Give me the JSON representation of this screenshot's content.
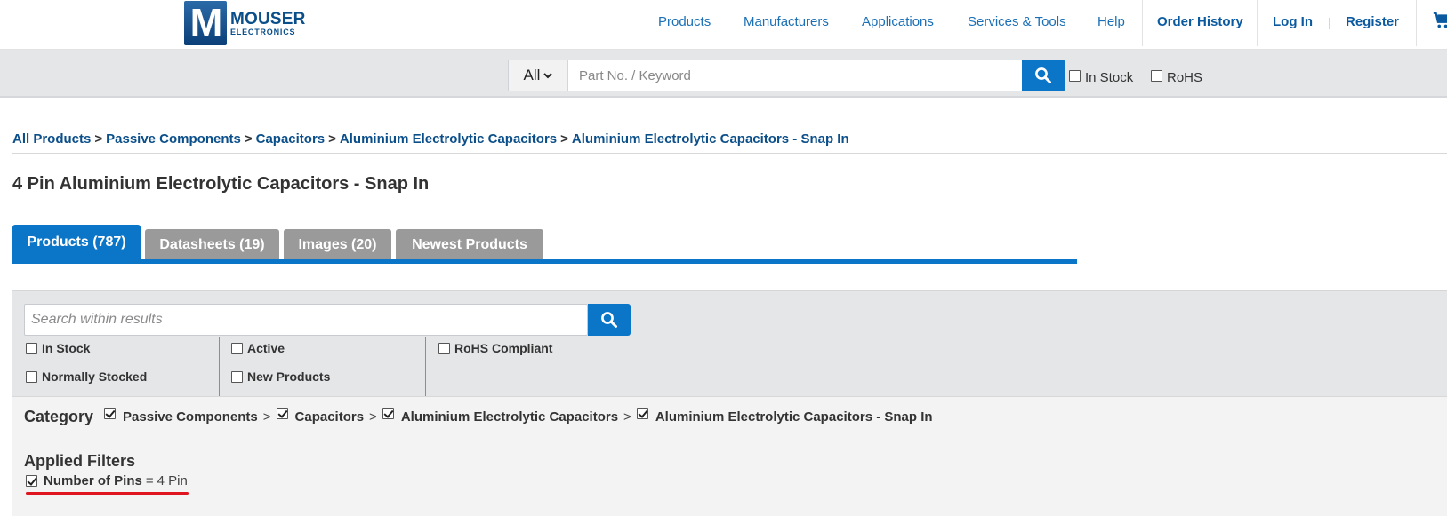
{
  "brand": {
    "mark": "M",
    "line1": "MOUSER",
    "line2": "ELECTRONICS"
  },
  "nav": {
    "products": "Products",
    "manufacturers": "Manufacturers",
    "applications": "Applications",
    "services": "Services & Tools",
    "help": "Help",
    "order_history": "Order History",
    "login": "Log In",
    "pipe": "|",
    "register": "Register"
  },
  "search": {
    "scope": "All",
    "placeholder": "Part No. / Keyword",
    "in_stock_label": "In Stock",
    "rohs_label": "RoHS"
  },
  "breadcrumb": {
    "items": [
      "All Products",
      "Passive Components",
      "Capacitors",
      "Aluminium Electrolytic Capacitors",
      "Aluminium Electrolytic Capacitors - Snap In"
    ],
    "separator": ">"
  },
  "page_title": "4 Pin Aluminium Electrolytic Capacitors - Snap In",
  "tabs": [
    {
      "label": "Products (787)",
      "active": true
    },
    {
      "label": "Datasheets (19)",
      "active": false
    },
    {
      "label": "Images (20)",
      "active": false
    },
    {
      "label": "Newest Products",
      "active": false
    }
  ],
  "filters": {
    "search_placeholder": "Search within results",
    "in_stock": "In Stock",
    "normally_stocked": "Normally Stocked",
    "active": "Active",
    "new_products": "New Products",
    "rohs_compliant": "RoHS Compliant"
  },
  "category": {
    "label": "Category",
    "items": [
      "Passive Components",
      "Capacitors",
      "Aluminium Electrolytic Capacitors",
      "Aluminium Electrolytic Capacitors - Snap In"
    ],
    "separator": ">"
  },
  "applied_filters": {
    "title": "Applied Filters",
    "name": "Number of Pins",
    "eq": "=",
    "value": "4 Pin"
  },
  "colors": {
    "accent_blue": "#0b76c8",
    "link_blue": "#1a6fb6",
    "tab_gray": "#9a9a9a",
    "highlight_red": "#e0141e"
  },
  "icons": [
    "search-icon",
    "chevron-down-icon",
    "cart-icon",
    "checkbox-icon"
  ]
}
